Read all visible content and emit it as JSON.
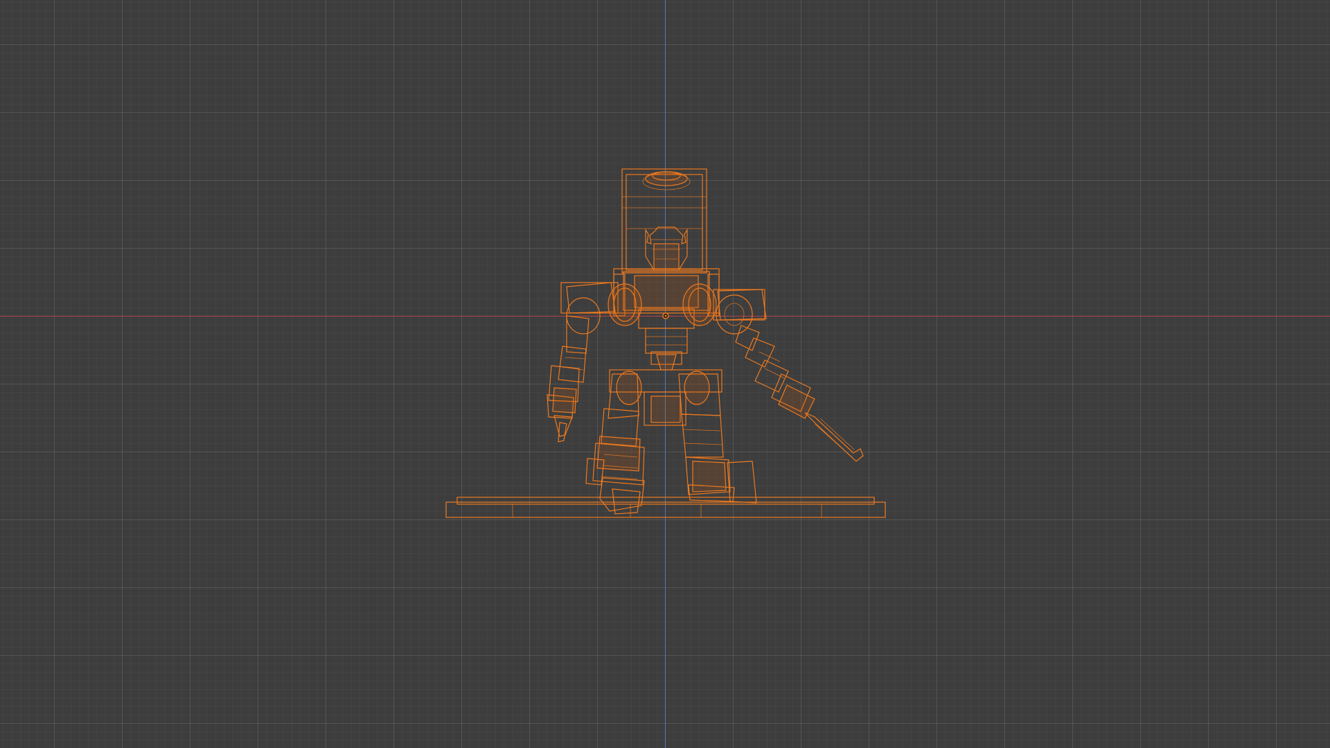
{
  "viewport": {
    "background_color": "#3d3d3d",
    "x_axis_color": "#b3454c",
    "z_axis_color": "#4a7fbd",
    "selection_color": "#f07a1e",
    "selection_dark": "#c25a0c",
    "origin_icon": "object-origin-icon",
    "model_icon": "wireframe-robot-icon"
  }
}
